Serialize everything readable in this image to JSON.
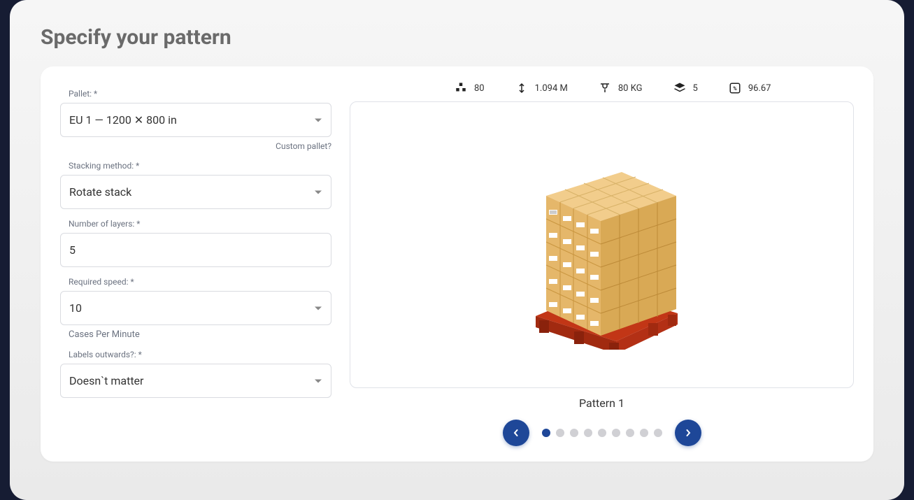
{
  "title": "Specify your pattern",
  "form": {
    "pallet": {
      "label": "Pallet: *",
      "value": "EU 1 — 1200 ✕ 800 in",
      "custom_link": "Custom pallet?"
    },
    "stacking": {
      "label": "Stacking method: *",
      "value": "Rotate stack"
    },
    "layers": {
      "label": "Number of layers: *",
      "value": "5"
    },
    "speed": {
      "label": "Required speed: *",
      "value": "10",
      "hint": "Cases Per Minute"
    },
    "labels": {
      "label": "Labels outwards?: *",
      "value": "Doesn`t matter"
    }
  },
  "stats": {
    "count": "80",
    "height": "1.094 M",
    "weight": "80 KG",
    "layers": "5",
    "efficiency": "96.67"
  },
  "pattern_label": "Pattern 1",
  "dot_count": 9,
  "active_dot": 0
}
